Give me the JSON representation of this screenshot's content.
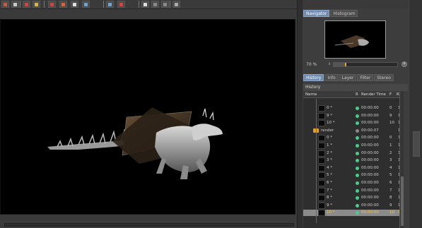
{
  "toolbar": {
    "buttons": [
      {
        "name": "render-window-icon",
        "color": "#c85a3a"
      },
      {
        "name": "grid-icon",
        "color": "#c8c8c8"
      },
      {
        "name": "film-icon",
        "color": "#d94040"
      },
      {
        "name": "layer-icon",
        "color": "#e0b040"
      },
      {
        "name": "save-icon",
        "color": "#d94040"
      },
      {
        "name": "save-as-icon",
        "color": "#e06030"
      },
      {
        "name": "camera-icon",
        "color": "#dddddd"
      },
      {
        "name": "picture-icon",
        "color": "#6fa0d8"
      },
      {
        "name": "compare-icon",
        "color": "#6fa0d8"
      },
      {
        "name": "ab-icon",
        "color": "#e04040"
      },
      {
        "name": "channels-icon",
        "color": "#dddddd"
      },
      {
        "name": "copy-icon",
        "color": "#888888"
      },
      {
        "name": "paste-icon",
        "color": "#888888"
      },
      {
        "name": "info-icon",
        "color": "#aaaaaa"
      }
    ]
  },
  "navigator": {
    "tabs": [
      "Navigator",
      "Histogram"
    ],
    "active_tab": "Navigator",
    "zoom_label": "70 %",
    "zoom_value_fraction": 0.18
  },
  "history": {
    "tabs": [
      "History",
      "Info",
      "Layer",
      "Filter",
      "Stereo"
    ],
    "active_tab": "History",
    "title": "History",
    "columns": [
      "Name",
      "R",
      "Render Time",
      "F",
      "R"
    ],
    "rows": [
      {
        "name": "0 *",
        "status": "green",
        "time": "00:00:00",
        "frame": "0",
        "c": "1"
      },
      {
        "name": "9 *",
        "status": "green",
        "time": "00:00:00",
        "frame": "9",
        "c": "1"
      },
      {
        "name": "10 *",
        "status": "green",
        "time": "00:00:00",
        "frame": "10",
        "c": "1"
      },
      {
        "name": "render",
        "status": "gray",
        "time": "00:00:07",
        "frame": "",
        "c": "1",
        "group": true
      },
      {
        "name": "0 *",
        "status": "green",
        "time": "00:00:00",
        "frame": "0",
        "c": "1"
      },
      {
        "name": "1 *",
        "status": "green",
        "time": "00:00:00",
        "frame": "1",
        "c": "1"
      },
      {
        "name": "2 *",
        "status": "green",
        "time": "00:00:00",
        "frame": "2",
        "c": "1"
      },
      {
        "name": "3 *",
        "status": "green",
        "time": "00:00:00",
        "frame": "3",
        "c": "1"
      },
      {
        "name": "4 *",
        "status": "green",
        "time": "00:00:00",
        "frame": "4",
        "c": "1"
      },
      {
        "name": "5 *",
        "status": "green",
        "time": "00:00:00",
        "frame": "5",
        "c": "1"
      },
      {
        "name": "6 *",
        "status": "green",
        "time": "00:00:00",
        "frame": "6",
        "c": "1"
      },
      {
        "name": "7 *",
        "status": "green",
        "time": "00:00:00",
        "frame": "7",
        "c": "1"
      },
      {
        "name": "8 *",
        "status": "green",
        "time": "00:00:00",
        "frame": "8",
        "c": "1"
      },
      {
        "name": "9 *",
        "status": "green",
        "time": "00:00:00",
        "frame": "9",
        "c": "1"
      },
      {
        "name": "10 *",
        "status": "green",
        "time": "00:00:00",
        "frame": "10",
        "c": "1",
        "highlight": true
      }
    ]
  },
  "colors": {
    "accent": "#6f8cb0",
    "status_green": "#41d28a",
    "highlight_text": "#ffc23a"
  }
}
